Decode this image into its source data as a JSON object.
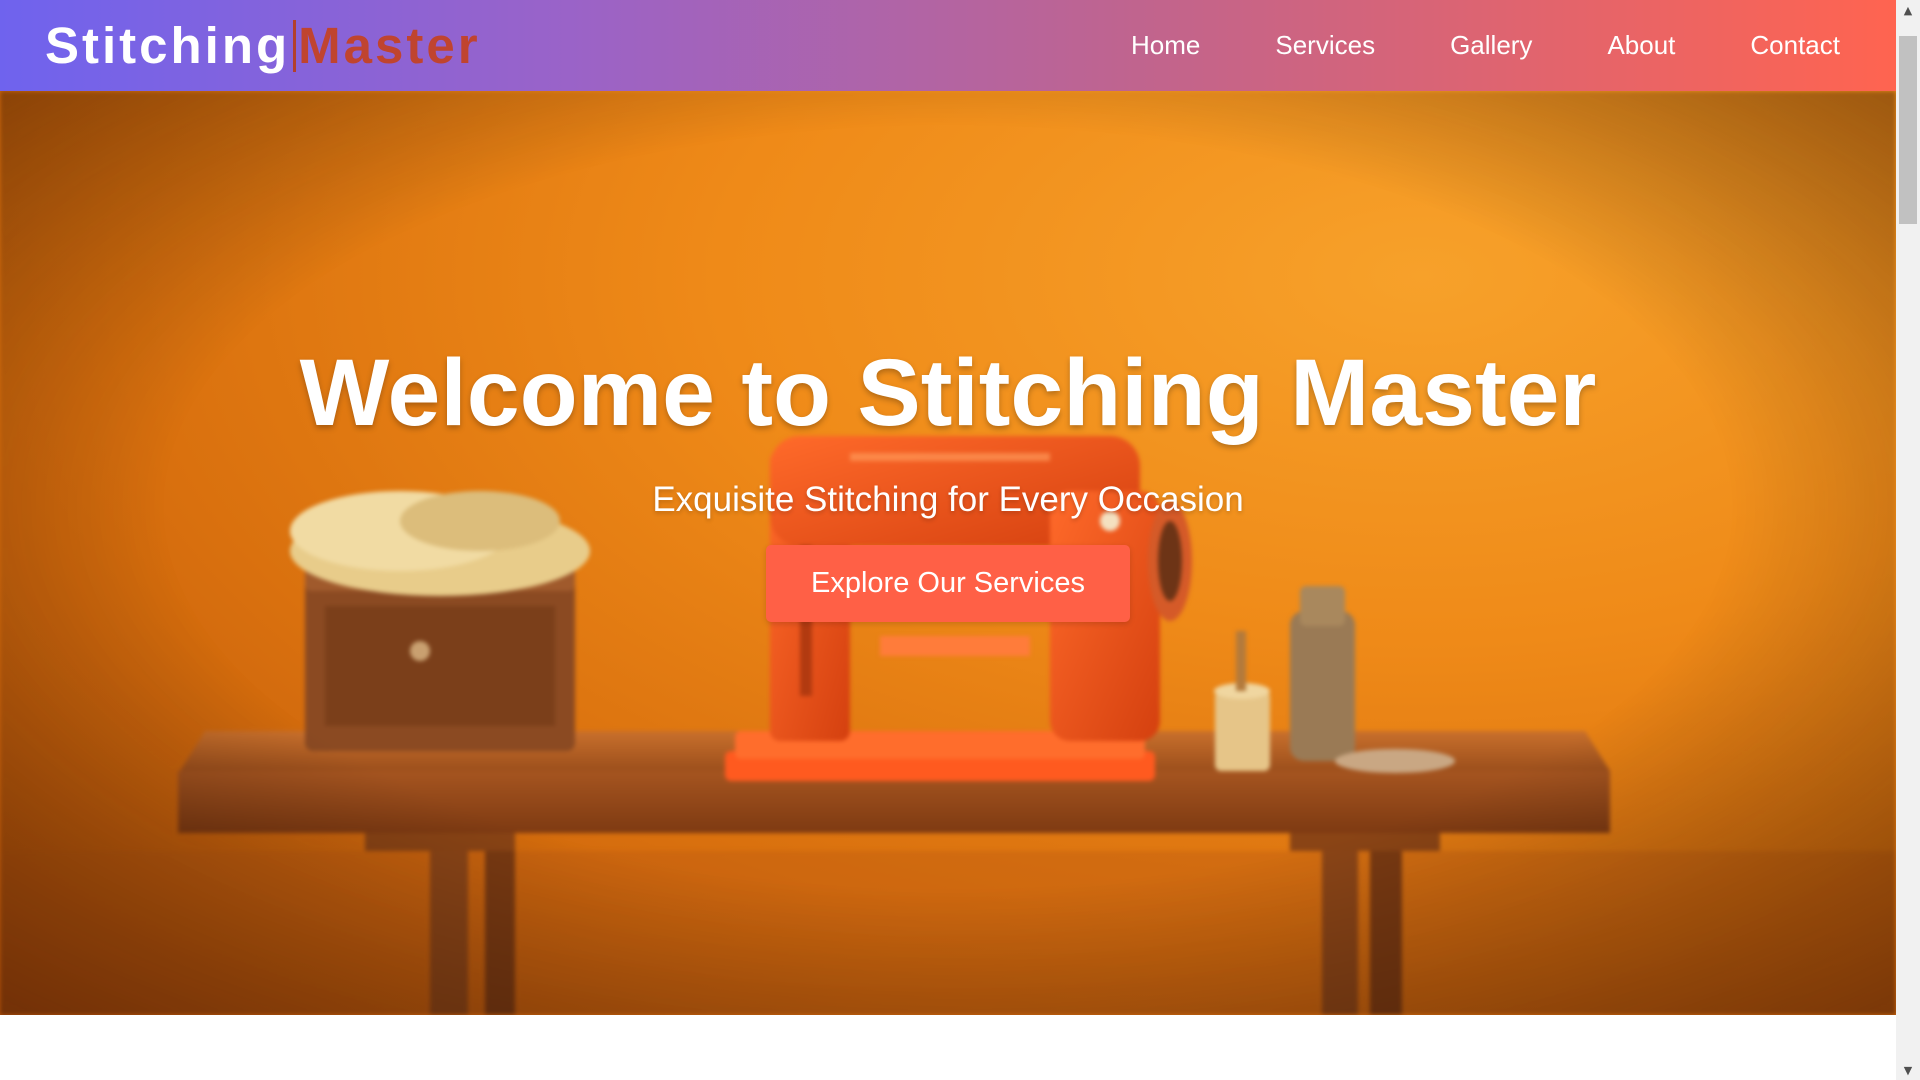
{
  "navbar": {
    "logo_part1": "Stitching",
    "logo_part2": "Master",
    "links": [
      "Home",
      "Services",
      "Gallery",
      "About",
      "Contact"
    ]
  },
  "hero": {
    "title": "Welcome to Stitching Master",
    "subtitle": "Exquisite Stitching for Every Occasion",
    "cta_label": "Explore Our Services",
    "background_image": "sewing-machine-on-wooden-table"
  },
  "colors": {
    "navbar_gradient_start": "#6f63ee",
    "navbar_gradient_end": "#ff6450",
    "logo_accent": "#c0442f",
    "cta_background": "#ff6046",
    "hero_background": "#ef8a18"
  },
  "scrollbar": {
    "up_icon": "scroll-up-arrow-icon",
    "down_icon": "scroll-down-arrow-icon"
  }
}
